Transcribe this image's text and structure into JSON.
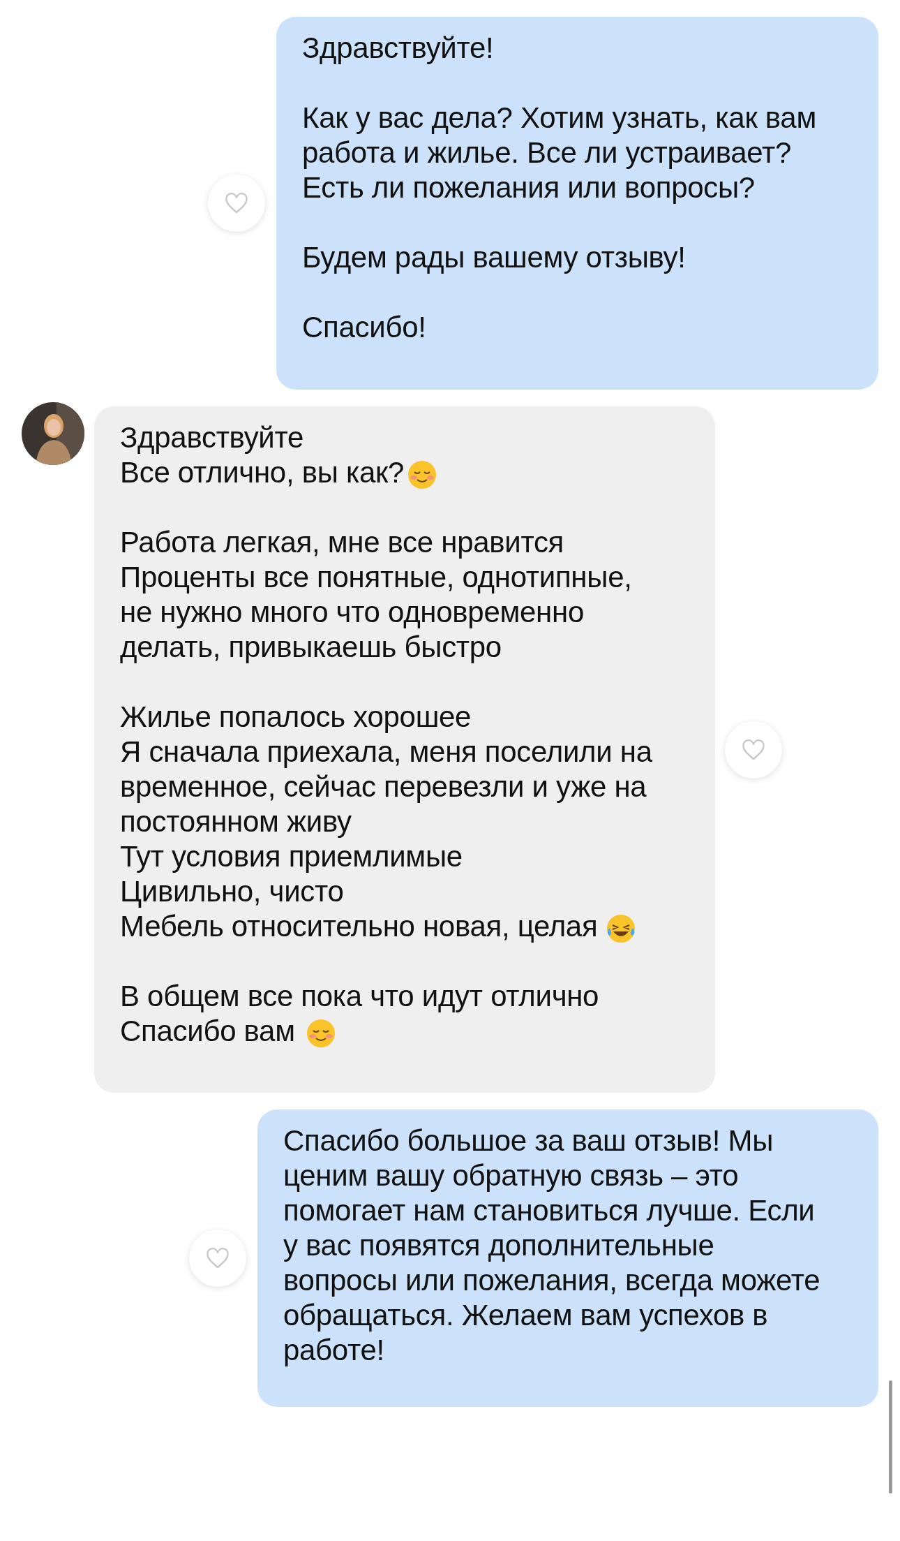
{
  "messages": [
    {
      "kind": "outgoing",
      "liked": false,
      "lines": [
        {
          "kind": "plain",
          "text": "Здравствуйте!"
        },
        {
          "kind": "blank"
        },
        {
          "kind": "plain",
          "text": "Как у вас дела? Хотим узнать, как вам"
        },
        {
          "kind": "plain",
          "text": "работа и жилье. Все ли устраивает?"
        },
        {
          "kind": "plain",
          "text": "Есть ли пожелания или вопросы?"
        },
        {
          "kind": "blank"
        },
        {
          "kind": "plain",
          "text": "Будем рады вашему отзыву!"
        },
        {
          "kind": "blank"
        },
        {
          "kind": "plain",
          "text": "Спасибо!"
        }
      ]
    },
    {
      "kind": "incoming",
      "liked": false,
      "lines": [
        {
          "kind": "plain",
          "text": "Здравствуйте"
        },
        {
          "kind": "smiling",
          "text": "Все отлично, вы как?"
        },
        {
          "kind": "blank"
        },
        {
          "kind": "plain",
          "text": "Работа легкая, мне все нравится"
        },
        {
          "kind": "plain",
          "text": "Проценты все понятные, однотипные,"
        },
        {
          "kind": "plain",
          "text": "не нужно много что одновременно"
        },
        {
          "kind": "plain",
          "text": "делать, привыкаешь быстро"
        },
        {
          "kind": "blank"
        },
        {
          "kind": "plain",
          "text": "Жилье попалось хорошее"
        },
        {
          "kind": "plain",
          "text": "Я сначала приехала, меня поселили на"
        },
        {
          "kind": "plain",
          "text": "временное, сейчас перевезли и уже на"
        },
        {
          "kind": "plain",
          "text": "постоянном живу"
        },
        {
          "kind": "plain",
          "text": "Тут условия приемлимые"
        },
        {
          "kind": "plain",
          "text": "Цивильно, чисто"
        },
        {
          "kind": "laughing",
          "text": "Мебель относительно новая, целая "
        },
        {
          "kind": "blank"
        },
        {
          "kind": "plain",
          "text": "В общем все пока что идут отлично"
        },
        {
          "kind": "smiling",
          "text": "Спасибо вам "
        }
      ]
    },
    {
      "kind": "outgoing",
      "liked": false,
      "lines": [
        {
          "kind": "plain",
          "text": "Спасибо большое за ваш отзыв! Мы"
        },
        {
          "kind": "plain",
          "text": "ценим вашу обратную связь – это"
        },
        {
          "kind": "plain",
          "text": "помогает нам становиться лучше. Если"
        },
        {
          "kind": "plain",
          "text": "у вас появятся дополнительные"
        },
        {
          "kind": "plain",
          "text": "вопросы или пожелания, всегда можете"
        },
        {
          "kind": "plain",
          "text": "обращаться. Желаем вам успехов в"
        },
        {
          "kind": "plain",
          "text": "работе!"
        }
      ]
    }
  ]
}
